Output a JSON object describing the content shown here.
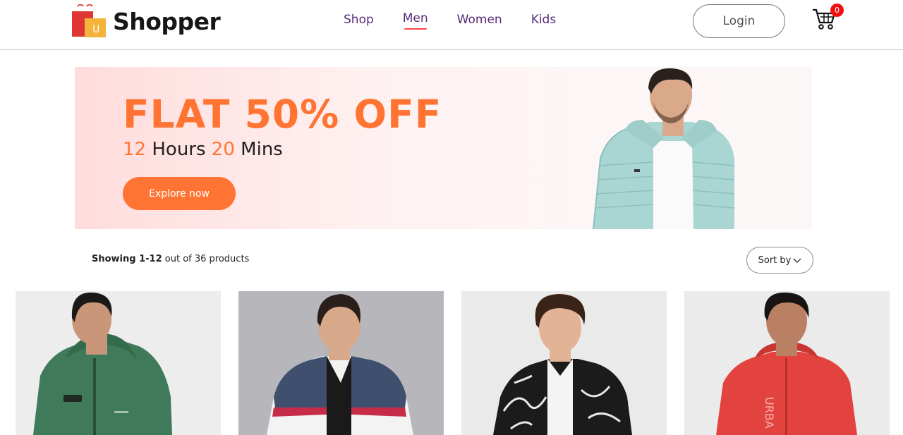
{
  "brand": {
    "name": "Shopper",
    "logo_letter": "U"
  },
  "nav": {
    "items": [
      {
        "label": "Shop"
      },
      {
        "label": "Men",
        "active": true
      },
      {
        "label": "Women"
      },
      {
        "label": "Kids"
      }
    ]
  },
  "header": {
    "login_label": "Login",
    "cart_count": "0"
  },
  "hero": {
    "title": "FLAT 50% OFF",
    "hours": "12",
    "hours_label": "Hours",
    "mins": "20",
    "mins_label": "Mins",
    "cta": "Explore now"
  },
  "listing": {
    "showing_bold": "Showing 1-12",
    "showing_rest": "out of 36 products",
    "sort_label": "Sort by"
  },
  "colors": {
    "accent": "#ff7432",
    "nav_text": "#5a2a7a",
    "active_underline": "#ff4141",
    "badge": "#ee1111"
  }
}
